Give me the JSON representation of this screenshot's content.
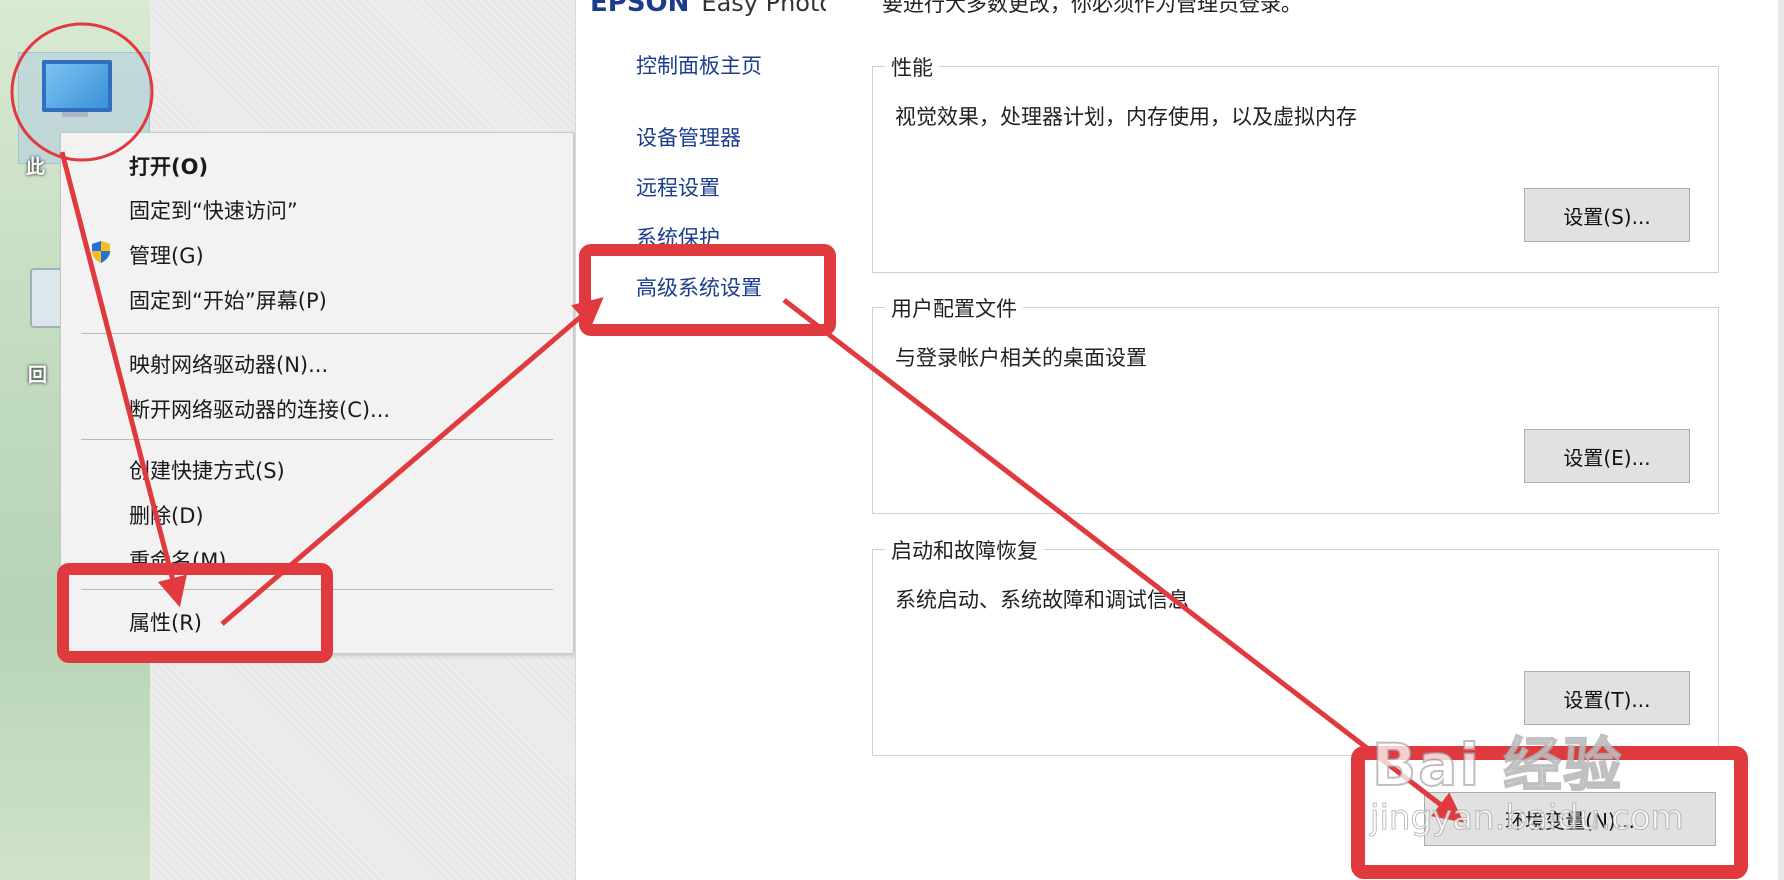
{
  "desktop": {
    "icon_this_pc_label": "此",
    "icon_recycle_label": "回"
  },
  "context_menu": {
    "items": [
      {
        "label": "打开(O)",
        "bold": true
      },
      {
        "label": "固定到“快速访问”"
      },
      {
        "label": "管理(G)",
        "icon": "uac-shield-icon"
      },
      {
        "label": "固定到“开始”屏幕(P)"
      },
      {
        "label": "映射网络驱动器(N)..."
      },
      {
        "label": "断开网络驱动器的连接(C)..."
      },
      {
        "label": "创建快捷方式(S)"
      },
      {
        "label": "删除(D)"
      },
      {
        "label": "重命名(M)"
      },
      {
        "label": "属性(R)"
      }
    ]
  },
  "left_nav": {
    "brand": "EPSON",
    "brand_suffix": "Easy Photo",
    "links": [
      "控制面板主页",
      "设备管理器",
      "远程设置",
      "系统保护",
      "高级系统设置"
    ]
  },
  "main": {
    "notice": "要进行大多数更改，你必须作为管理员登录。",
    "groups": [
      {
        "title": "性能",
        "desc": "视觉效果，处理器计划，内存使用，以及虚拟内存",
        "button": "设置(S)..."
      },
      {
        "title": "用户配置文件",
        "desc": "与登录帐户相关的桌面设置",
        "button": "设置(E)..."
      },
      {
        "title": "启动和故障恢复",
        "desc": "系统启动、系统故障和调试信息",
        "button": "设置(T)..."
      }
    ],
    "env_button": "环境变量(N)..."
  },
  "watermark": {
    "text": "Bai 经验",
    "sub": "jingyan.baidu.com"
  },
  "colors": {
    "annotation_red": "#e0393e",
    "link_blue": "#1a3e8c"
  }
}
